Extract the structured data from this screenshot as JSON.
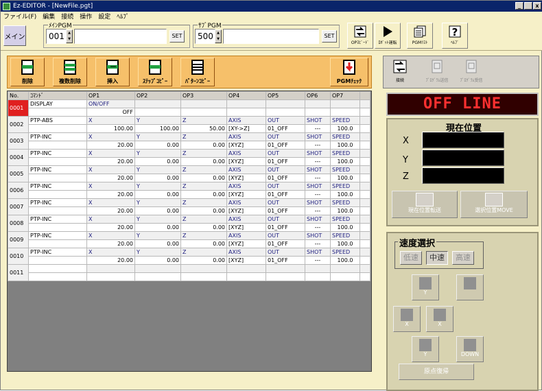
{
  "window": {
    "title": "Ez-EDITOR - [NewFile.pgt]",
    "controls": [
      "_",
      " ",
      "x"
    ]
  },
  "menu": [
    "ファイル(F)",
    "編集",
    "接続",
    "操作",
    "設定",
    "ﾍﾙﾌﾟ"
  ],
  "top": {
    "main_label": "メイン",
    "main_pgm_title": "ﾒｲﾝPGM",
    "main_pgm_value": "001",
    "sub_pgm_title": "ｻﾌﾞPGM",
    "sub_pgm_value": "500",
    "set_label": "SET",
    "tools": [
      "OPｽﾋﾟｰﾄﾞ",
      "ﾛﾎﾞｯﾄ運転",
      "PGMﾘｽﾄ",
      "ﾍﾙﾌﾟ"
    ]
  },
  "cmd_toolbar": {
    "buttons": [
      "削除",
      "複数削除",
      "挿入",
      "ｽﾃｯﾌﾟｺﾋﾟｰ",
      "ﾊﾟﾀｰﾝｺﾋﾟｰ"
    ],
    "check": "PGMﾁｪｯｸ"
  },
  "grid": {
    "headers": [
      "No.",
      "ｺﾏﾝﾄﾞ",
      "OP1",
      "OP2",
      "OP3",
      "OP4",
      "OP5",
      "OP6",
      "OP7"
    ],
    "rows": [
      {
        "no": "0001",
        "cmd": "DISPLAY",
        "l1": [
          "ON/OFF",
          "",
          "",
          "",
          "",
          "",
          ""
        ],
        "l2": [
          "OFF",
          "",
          "",
          "",
          "",
          "",
          ""
        ]
      },
      {
        "no": "0002",
        "cmd": "PTP-ABS",
        "l1": [
          "X",
          "Y",
          "Z",
          "AXIS",
          "OUT",
          "SHOT",
          "SPEED"
        ],
        "l2": [
          "100.00",
          "100.00",
          "50.00",
          "[XY->Z]",
          "01_OFF",
          "---",
          "100.0"
        ]
      },
      {
        "no": "0003",
        "cmd": "PTP-INC",
        "l1": [
          "X",
          "Y",
          "Z",
          "AXIS",
          "OUT",
          "SHOT",
          "SPEED"
        ],
        "l2": [
          "20.00",
          "0.00",
          "0.00",
          "[XYZ]",
          "01_OFF",
          "---",
          "100.0"
        ]
      },
      {
        "no": "0004",
        "cmd": "PTP-INC",
        "l1": [
          "X",
          "Y",
          "Z",
          "AXIS",
          "OUT",
          "SHOT",
          "SPEED"
        ],
        "l2": [
          "20.00",
          "0.00",
          "0.00",
          "[XYZ]",
          "01_OFF",
          "---",
          "100.0"
        ]
      },
      {
        "no": "0005",
        "cmd": "PTP-INC",
        "l1": [
          "X",
          "Y",
          "Z",
          "AXIS",
          "OUT",
          "SHOT",
          "SPEED"
        ],
        "l2": [
          "20.00",
          "0.00",
          "0.00",
          "[XYZ]",
          "01_OFF",
          "---",
          "100.0"
        ]
      },
      {
        "no": "0006",
        "cmd": "PTP-INC",
        "l1": [
          "X",
          "Y",
          "Z",
          "AXIS",
          "OUT",
          "SHOT",
          "SPEED"
        ],
        "l2": [
          "20.00",
          "0.00",
          "0.00",
          "[XYZ]",
          "01_OFF",
          "---",
          "100.0"
        ]
      },
      {
        "no": "0007",
        "cmd": "PTP-INC",
        "l1": [
          "X",
          "Y",
          "Z",
          "AXIS",
          "OUT",
          "SHOT",
          "SPEED"
        ],
        "l2": [
          "20.00",
          "0.00",
          "0.00",
          "[XYZ]",
          "01_OFF",
          "---",
          "100.0"
        ]
      },
      {
        "no": "0008",
        "cmd": "PTP-INC",
        "l1": [
          "X",
          "Y",
          "Z",
          "AXIS",
          "OUT",
          "SHOT",
          "SPEED"
        ],
        "l2": [
          "20.00",
          "0.00",
          "0.00",
          "[XYZ]",
          "01_OFF",
          "---",
          "100.0"
        ]
      },
      {
        "no": "0009",
        "cmd": "PTP-INC",
        "l1": [
          "X",
          "Y",
          "Z",
          "AXIS",
          "OUT",
          "SHOT",
          "SPEED"
        ],
        "l2": [
          "20.00",
          "0.00",
          "0.00",
          "[XYZ]",
          "01_OFF",
          "---",
          "100.0"
        ]
      },
      {
        "no": "0010",
        "cmd": "PTP-INC",
        "l1": [
          "X",
          "Y",
          "Z",
          "AXIS",
          "OUT",
          "SHOT",
          "SPEED"
        ],
        "l2": [
          "20.00",
          "0.00",
          "0.00",
          "[XYZ]",
          "01_OFF",
          "---",
          "100.0"
        ]
      },
      {
        "no": "0011",
        "cmd": "",
        "l1": [
          "",
          "",
          "",
          "",
          "",
          "",
          ""
        ],
        "l2": [
          "",
          "",
          "",
          "",
          "",
          "",
          ""
        ]
      }
    ]
  },
  "right": {
    "tools": [
      "接続",
      "ﾌﾟﾛｸﾞﾗﾑ送信",
      "ﾌﾟﾛｸﾞﾗﾑ受信"
    ],
    "status": "OFF LINE",
    "position_title": "現在位置",
    "axes": [
      "X",
      "Y",
      "Z"
    ],
    "pos_buttons": [
      "現在位置転送",
      "選択位置MOVE"
    ],
    "speed_title": "速度選択",
    "speeds": [
      "低速",
      "中速",
      "高速"
    ],
    "jog": {
      "y_plus": "Y",
      "z_up": "UP",
      "x_minus": "X",
      "x_plus": "X",
      "y_minus": "Y",
      "z_down": "DOWN"
    },
    "home": "原点復帰"
  }
}
